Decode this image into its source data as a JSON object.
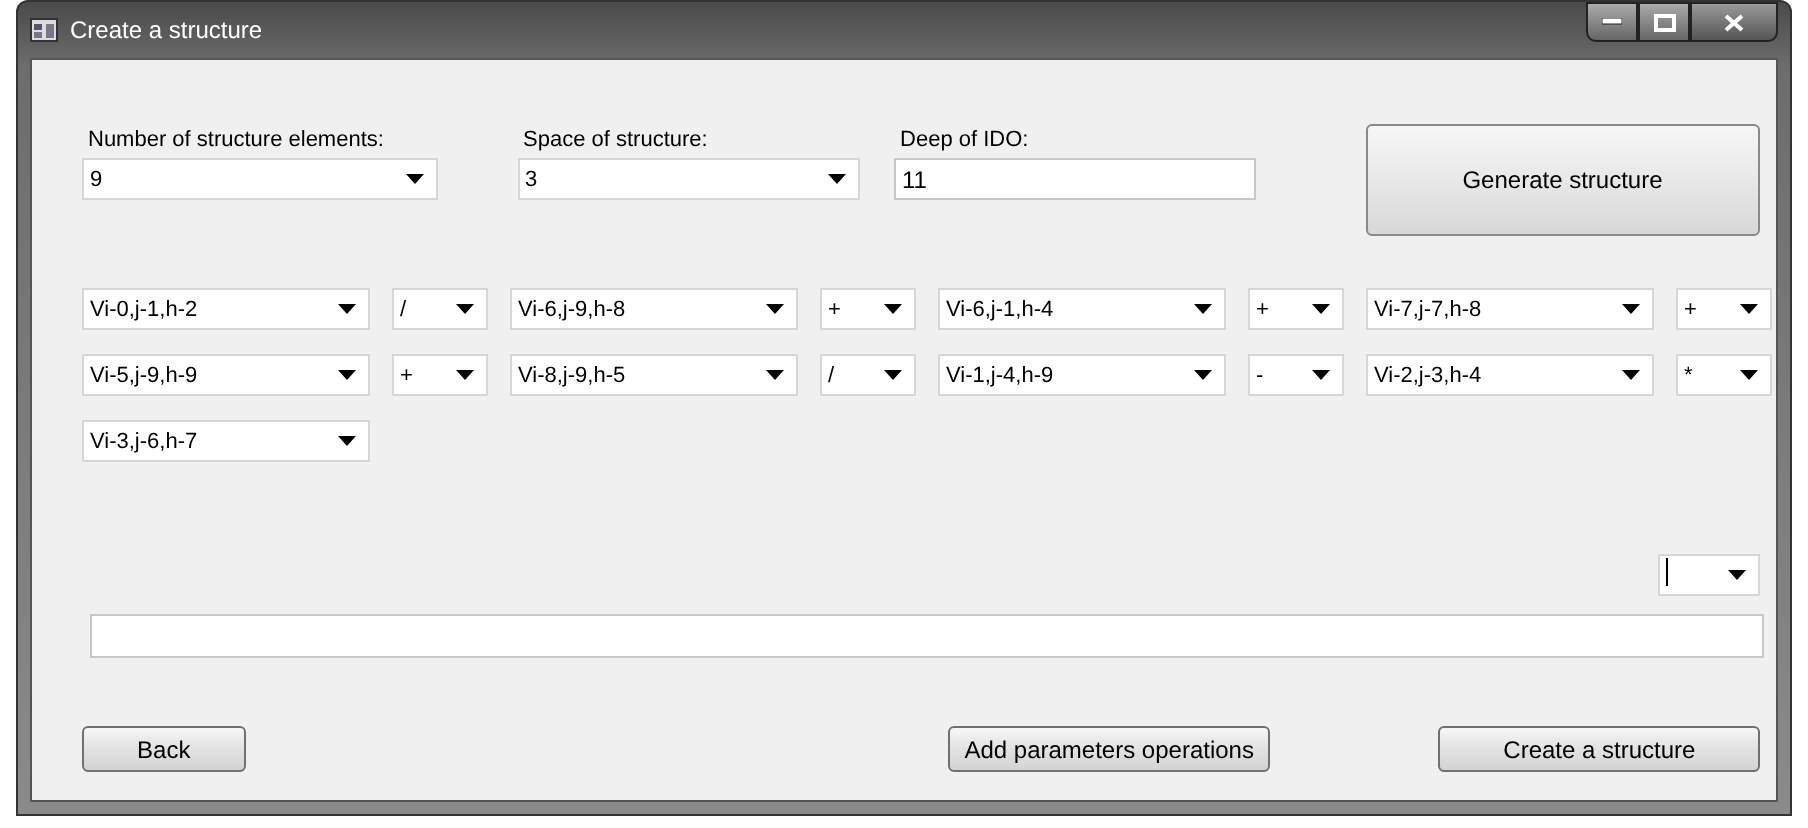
{
  "window": {
    "title": "Create a structure"
  },
  "settings": [
    {
      "label": "Number of structure elements:",
      "kind": "dropdown",
      "value": "9"
    },
    {
      "label": "Space of structure:",
      "kind": "dropdown",
      "value": "3"
    },
    {
      "label": "Deep of IDO:",
      "kind": "text",
      "value": "11"
    }
  ],
  "generate_button": "Generate structure",
  "structure_items": [
    {
      "kind": "element",
      "value": "Vi-0,j-1,h-2"
    },
    {
      "kind": "operation",
      "value": "/"
    },
    {
      "kind": "element",
      "value": "Vi-6,j-9,h-8"
    },
    {
      "kind": "operation",
      "value": "+"
    },
    {
      "kind": "element",
      "value": "Vi-6,j-1,h-4"
    },
    {
      "kind": "operation",
      "value": "+"
    },
    {
      "kind": "element",
      "value": "Vi-7,j-7,h-8"
    },
    {
      "kind": "operation",
      "value": "+"
    },
    {
      "kind": "element",
      "value": "Vi-5,j-9,h-9"
    },
    {
      "kind": "operation",
      "value": "+"
    },
    {
      "kind": "element",
      "value": "Vi-8,j-9,h-5"
    },
    {
      "kind": "operation",
      "value": "/"
    },
    {
      "kind": "element",
      "value": "Vi-1,j-4,h-9"
    },
    {
      "kind": "operation",
      "value": "-"
    },
    {
      "kind": "element",
      "value": "Vi-2,j-3,h-4"
    },
    {
      "kind": "operation",
      "value": "*"
    },
    {
      "kind": "element",
      "value": "Vi-3,j-6,h-7"
    }
  ],
  "parameter_operation": {
    "focused": true
  },
  "buttons": [
    {
      "label": "Back",
      "kind": "left"
    },
    {
      "label": "Add parameters operations",
      "kind": "middle"
    },
    {
      "label": "Create a structure",
      "kind": "right"
    }
  ]
}
